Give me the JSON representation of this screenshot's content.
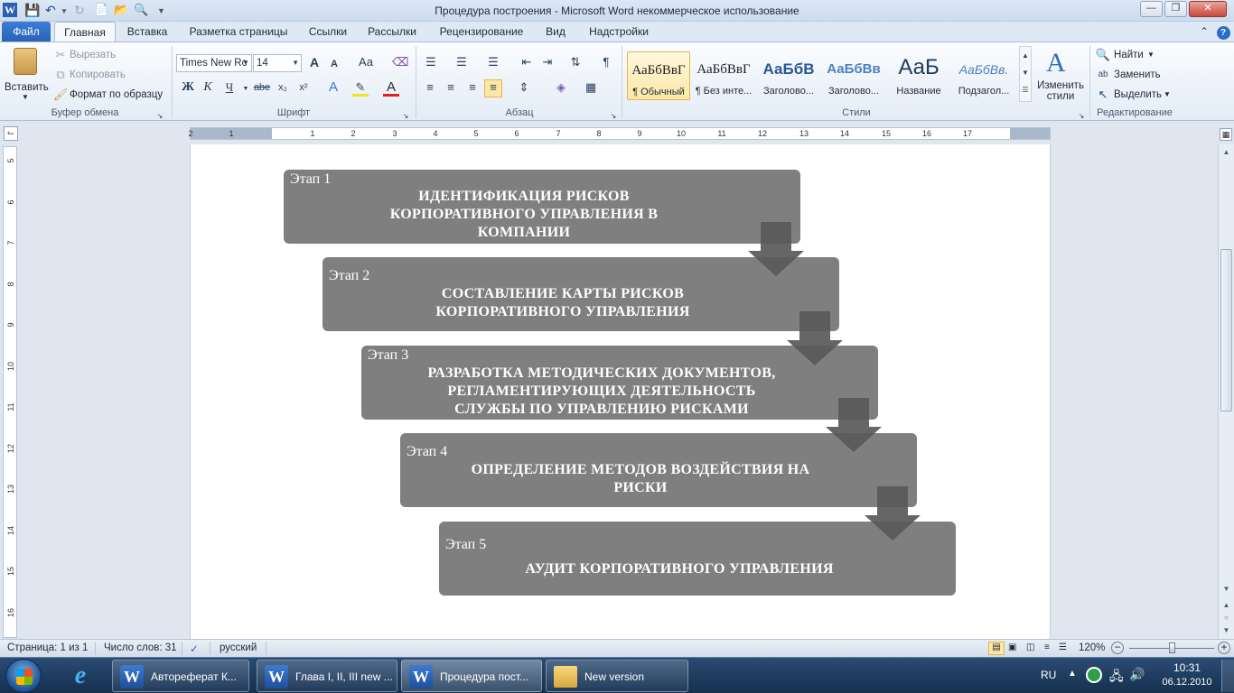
{
  "window": {
    "title": "Процедура построения  -  Microsoft Word некоммерческое использование"
  },
  "tabs": [
    "Файл",
    "Главная",
    "Вставка",
    "Разметка страницы",
    "Ссылки",
    "Рассылки",
    "Рецензирование",
    "Вид",
    "Надстройки"
  ],
  "ribbon": {
    "clipboard": {
      "paste": "Вставить",
      "cut": "Вырезать",
      "copy": "Копировать",
      "format_painter": "Формат по образцу",
      "label": "Буфер обмена"
    },
    "font": {
      "font_name": "Times New Rc",
      "font_size": "14",
      "grow": "A",
      "shrink": "A",
      "change_case": "Aa",
      "bold": "Ж",
      "italic": "К",
      "underline": "Ч",
      "strike": "abe",
      "subscript": "x₂",
      "superscript": "x²",
      "label": "Шрифт"
    },
    "paragraph": {
      "label": "Абзац"
    },
    "styles": {
      "items": [
        {
          "sample": "АаБбВвГ",
          "name": "¶ Обычный"
        },
        {
          "sample": "АаБбВвГ",
          "name": "¶ Без инте..."
        },
        {
          "sample": "АаБбВ",
          "name": "Заголово..."
        },
        {
          "sample": "АаБбВв",
          "name": "Заголово..."
        },
        {
          "sample": "АаБ",
          "name": "Название"
        },
        {
          "sample": "АаБбВв.",
          "name": "Подзагол..."
        }
      ],
      "change_styles": "Изменить стили",
      "label": "Стили"
    },
    "editing": {
      "find": "Найти",
      "replace": "Заменить",
      "select": "Выделить",
      "label": "Редактирование"
    }
  },
  "ruler": {
    "h_numbers": [
      "2",
      "1",
      "1",
      "2",
      "3",
      "4",
      "5",
      "6",
      "7",
      "8",
      "9",
      "10",
      "11",
      "12",
      "13",
      "14",
      "15",
      "16",
      "17"
    ],
    "v_numbers": [
      "5",
      "6",
      "7",
      "8",
      "9",
      "10",
      "11",
      "12",
      "13",
      "14",
      "15",
      "16"
    ]
  },
  "diagram": {
    "stages": [
      {
        "label": "Этап 1",
        "lines": [
          "ИДЕНТИФИКАЦИЯ  РИСКОВ",
          "КОРПОРАТИВНОГО УПРАВЛЕНИЯ  В",
          "КОМПАНИИ"
        ]
      },
      {
        "label": "Этап 2",
        "lines": [
          "СОСТАВЛЕНИЕ  КАРТЫ РИСКОВ",
          "КОРПОРАТИВНОГО УПРАВЛЕНИЯ"
        ]
      },
      {
        "label": "Этап 3",
        "lines": [
          "РАЗРАБОТКА МЕТОДИЧЕСКИХ ДОКУМЕНТОВ,",
          "РЕГЛАМЕНТИРУЮЩИХ  ДЕЯТЕЛЬНОСТЬ",
          "СЛУЖБЫ ПО УПРАВЛЕНИЮ  РИСКАМИ"
        ]
      },
      {
        "label": "Этап 4",
        "lines": [
          "ОПРЕДЕЛЕНИЕ  МЕТОДОВ ВОЗДЕЙСТВИЯ НА",
          "РИСКИ"
        ]
      },
      {
        "label": "Этап 5",
        "lines": [
          "АУДИТ  КОРПОРАТИВНОГО УПРАВЛЕНИЯ"
        ]
      }
    ],
    "colors": {
      "box": "#7f7f7f",
      "arrow": "#595959"
    }
  },
  "status": {
    "page": "Страница: 1 из 1",
    "words": "Число слов: 31",
    "language": "русский",
    "zoom": "120%"
  },
  "taskbar": {
    "items": [
      {
        "label": "Автореферат К..."
      },
      {
        "label": "Глава I, II, III new ..."
      },
      {
        "label": "Процедура пост..."
      },
      {
        "label": "New version"
      }
    ],
    "lang": "RU",
    "time": "10:31",
    "date": "06.12.2010"
  }
}
